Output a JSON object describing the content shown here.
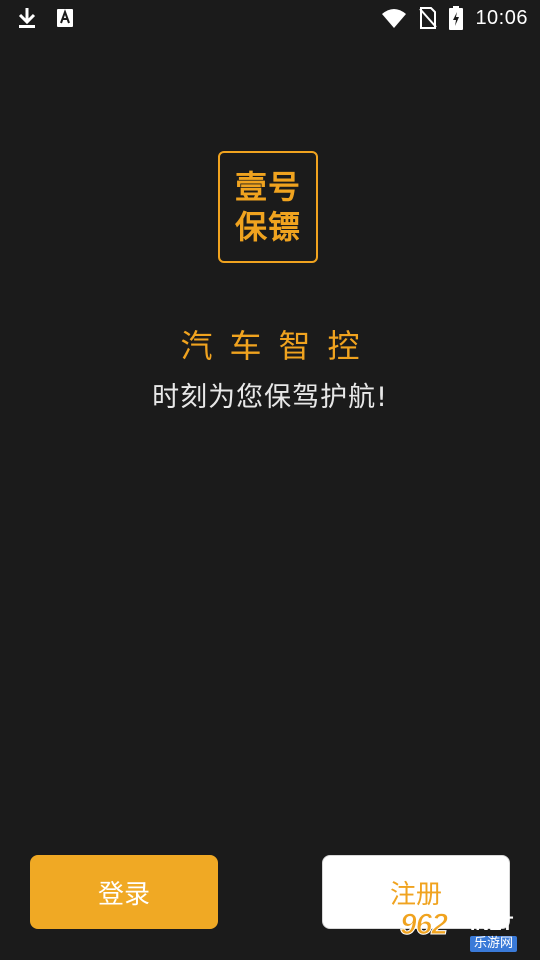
{
  "status_bar": {
    "time": "10:06",
    "icons_left": [
      "download-icon",
      "a-notification-icon"
    ],
    "icons_right": [
      "wifi-icon",
      "no-sim-icon",
      "battery-charging-icon"
    ]
  },
  "logo": {
    "line1": "壹号",
    "line2": "保镖"
  },
  "headline": "汽车智控",
  "tagline": "时刻为您保驾护航!",
  "buttons": {
    "login": "登录",
    "register": "注册"
  },
  "watermark": {
    "number": "962",
    "domain": ".NET",
    "site": "乐游网"
  },
  "colors": {
    "background": "#1b1b1b",
    "accent": "#f0a31f",
    "tagline": "#e8e8e8",
    "login_bg": "#f0a924",
    "register_bg": "#ffffff"
  }
}
